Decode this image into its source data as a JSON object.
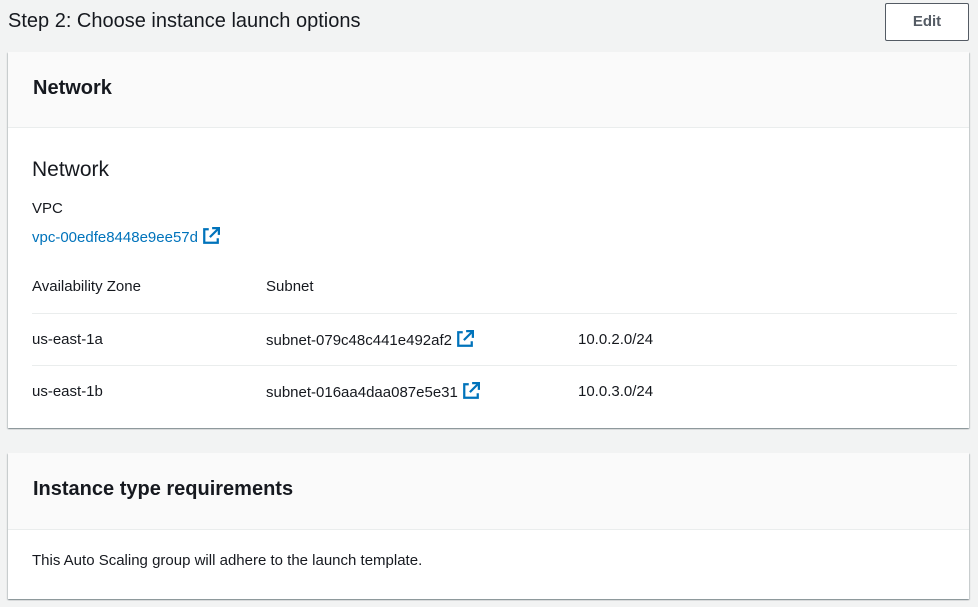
{
  "header": {
    "title": "Step 2: Choose instance launch options",
    "edit_label": "Edit"
  },
  "network_card": {
    "header_title": "Network",
    "section_title": "Network",
    "vpc_label": "VPC",
    "vpc_id": "vpc-00edfe8448e9ee57d",
    "table": {
      "columns": [
        "Availability Zone",
        "Subnet"
      ],
      "rows": [
        {
          "az": "us-east-1a",
          "subnet": "subnet-079c48c441e492af2",
          "cidr": "10.0.2.0/24"
        },
        {
          "az": "us-east-1b",
          "subnet": "subnet-016aa4daa087e5e31",
          "cidr": "10.0.3.0/24"
        }
      ]
    }
  },
  "instance_card": {
    "header_title": "Instance type requirements",
    "body_text": "This Auto Scaling group will adhere to the launch template."
  },
  "icons": {
    "external_link": "external-link-icon"
  },
  "colors": {
    "link": "#0073bb",
    "background": "#f2f3f3",
    "card": "#ffffff",
    "card_header": "#fafafa",
    "border": "#eaeded",
    "button_border": "#545b64"
  }
}
